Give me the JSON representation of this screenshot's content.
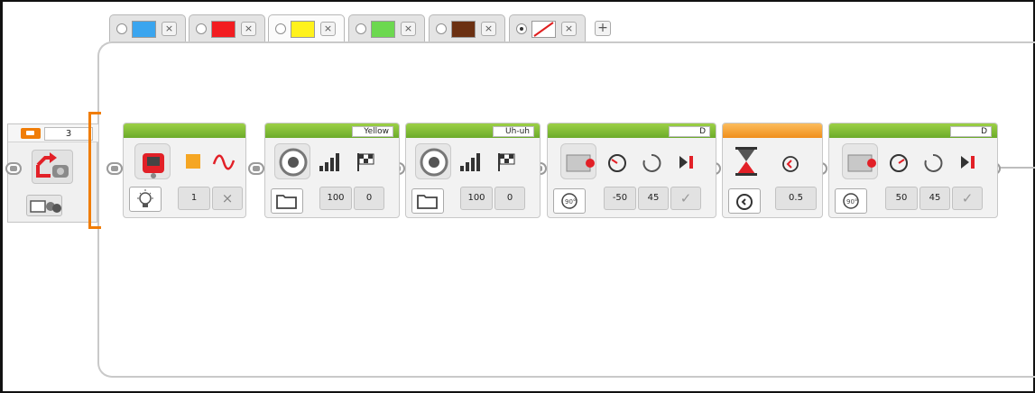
{
  "tabs": [
    {
      "name": "tab-blue",
      "color": "#3aa5ef",
      "radio": "off",
      "close": "×"
    },
    {
      "name": "tab-red",
      "color": "#f21c20",
      "radio": "off",
      "close": "×"
    },
    {
      "name": "tab-yellow",
      "color": "#fff21d",
      "radio": "off",
      "close": "×",
      "selected": true
    },
    {
      "name": "tab-green",
      "color": "#6cd84f",
      "radio": "off",
      "close": "×"
    },
    {
      "name": "tab-brown",
      "color": "#6b3012",
      "radio": "off",
      "close": "×"
    },
    {
      "name": "tab-no-color",
      "color": "none",
      "radio": "on",
      "close": "×"
    }
  ],
  "add_tab": "+",
  "loop": {
    "name": "3",
    "color": "#f07d08"
  },
  "blocks": {
    "status_light": {
      "value_color": "1",
      "value_pulse": "×",
      "icons": [
        "light-bulb-icon",
        "brick-icon",
        "square-icon",
        "sine-pulse-icon"
      ]
    },
    "sound1": {
      "name": "Yellow",
      "volume": "100",
      "play_type": "0"
    },
    "sound2": {
      "name": "Uh-uh",
      "volume": "100",
      "play_type": "0"
    },
    "motor1": {
      "port": "D",
      "power": "-50",
      "degrees": "45",
      "brake": "✓"
    },
    "wait": {
      "seconds": "0.5"
    },
    "motor2": {
      "port": "D",
      "power": "50",
      "degrees": "45",
      "brake": "✓"
    }
  },
  "colors": {
    "action": "#6bab2a",
    "flow": "#f08f1c",
    "loop": "#f07d08"
  }
}
